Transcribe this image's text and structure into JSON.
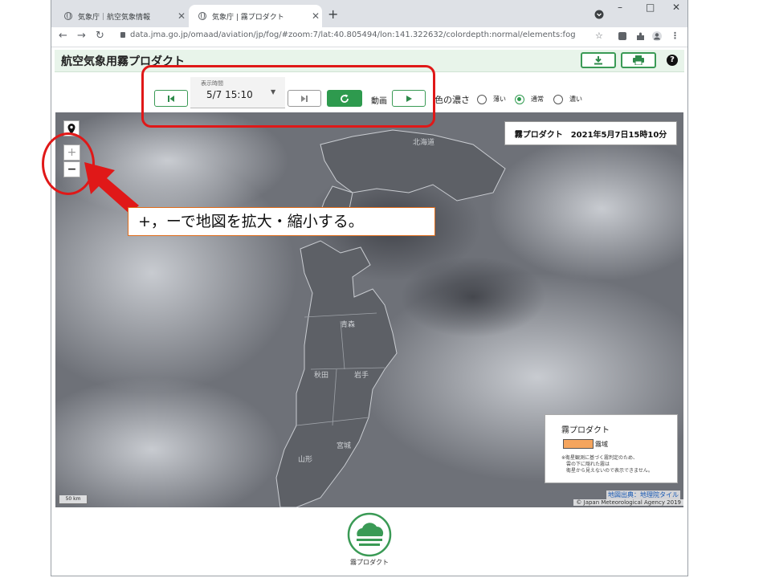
{
  "browser": {
    "tabs": [
      {
        "title": "気象庁｜航空気象情報"
      },
      {
        "title": "気象庁 | 霧プロダクト"
      }
    ],
    "new_tab_glyph": "+",
    "window_controls": {
      "minimize": "–",
      "maximize": "□",
      "close": "✕"
    },
    "url": "data.jma.go.jp/omaad/aviation/jp/fog/#zoom:7/lat:40.805494/lon:141.322632/colordepth:normal/elements:fog"
  },
  "app": {
    "title": "航空気象用霧プロダクト",
    "actions": {
      "download_icon": "download-icon",
      "print_icon": "printer-icon",
      "help_icon": "help-icon",
      "help_glyph": "?"
    }
  },
  "controls": {
    "time_label": "表示時間",
    "time_value": "5/7 15:10",
    "animation_label": "動画",
    "color_depth_label": "色の濃さ",
    "color_options": [
      {
        "label": "薄い",
        "selected": false
      },
      {
        "label": "通常",
        "selected": true
      },
      {
        "label": "濃い",
        "selected": false
      }
    ]
  },
  "map": {
    "zoom_in": "+",
    "zoom_out": "−",
    "product_timestamp": "霧プロダクト　2021年5月7日15時10分",
    "place_labels": [
      "北海道",
      "青森",
      "秋田",
      "岩手",
      "山形",
      "宮城"
    ],
    "legend": {
      "title": "霧プロダクト",
      "swatch_color": "#f5a55e",
      "item_label": "霧域",
      "note_lines": [
        "※衛星観測に基づく霧判定のため、",
        "雲の下に隠れた霧は",
        "衛星から見えないので表示できません。"
      ]
    },
    "scale_label": "50 km",
    "attribution_map": "地図出典：地理院タイル",
    "attribution_copyright": "© Japan Meteorological Agency 2019"
  },
  "bottom": {
    "logo_label": "霧プロダクト"
  },
  "annotation": {
    "callout_text": "+，ーで地図を拡大・縮小する。",
    "highlight_color": "#e01818"
  }
}
